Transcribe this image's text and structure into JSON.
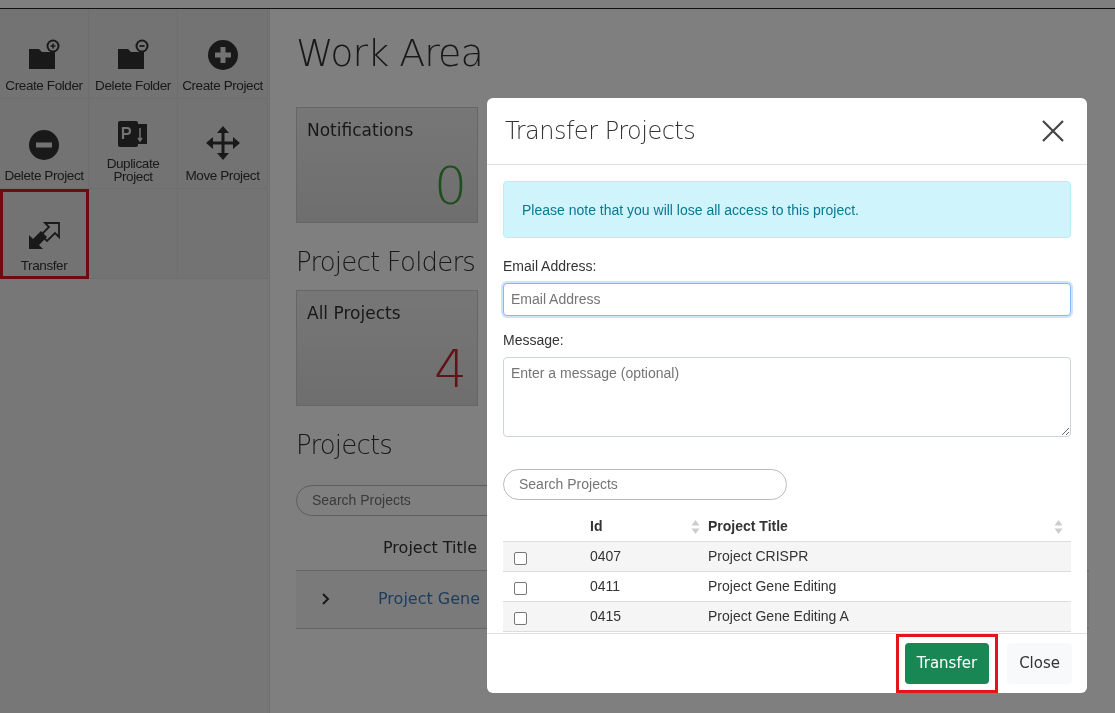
{
  "toolbar": {
    "tiles": [
      {
        "label": "Create Folder",
        "kind": "folderplus",
        "highlighted": false
      },
      {
        "label": "Delete Folder",
        "kind": "folderminus",
        "highlighted": false
      },
      {
        "label": "Create Project",
        "kind": "plus",
        "highlighted": false
      },
      {
        "label": "Delete Project",
        "kind": "minus",
        "highlighted": false
      },
      {
        "label": "Duplicate Project",
        "kind": "duplicate",
        "highlighted": false
      },
      {
        "label": "Move Project",
        "kind": "move",
        "highlighted": false
      },
      {
        "label": "Transfer",
        "kind": "transfer",
        "highlighted": true
      }
    ]
  },
  "work_area": {
    "title": "Work Area",
    "notifications": {
      "label": "Notifications",
      "count": "0"
    },
    "folders_heading": "Project Folders",
    "folder_card": {
      "label": "All Projects",
      "count": "4"
    },
    "projects_heading": "Projects",
    "search": {
      "placeholder": "Search Projects"
    },
    "table": {
      "columns": [
        "Project Title"
      ],
      "rows": [
        {
          "title": "Project Gene"
        }
      ]
    }
  },
  "modal": {
    "title": "Transfer Projects",
    "alert": "Please note that you will lose all access to this project.",
    "fields": [
      {
        "kind": "input",
        "label": "Email Address:",
        "placeholder": "Email Address",
        "focused": true
      },
      {
        "kind": "textarea",
        "label": "Message:",
        "placeholder": "Enter a message (optional)",
        "focused": false
      }
    ],
    "search": {
      "placeholder": "Search Projects"
    },
    "table": {
      "columns": [
        "Id",
        "Project Title"
      ],
      "rows": [
        {
          "id": "0407",
          "title": "Project CRISPR",
          "checked": false
        },
        {
          "id": "0411",
          "title": "Project Gene Editing",
          "checked": false
        },
        {
          "id": "0415",
          "title": "Project Gene Editing A",
          "checked": false
        }
      ]
    },
    "buttons": [
      {
        "label": "Transfer",
        "kind": "primary",
        "highlighted": true
      },
      {
        "label": "Close",
        "kind": "secondary",
        "highlighted": false
      }
    ]
  }
}
